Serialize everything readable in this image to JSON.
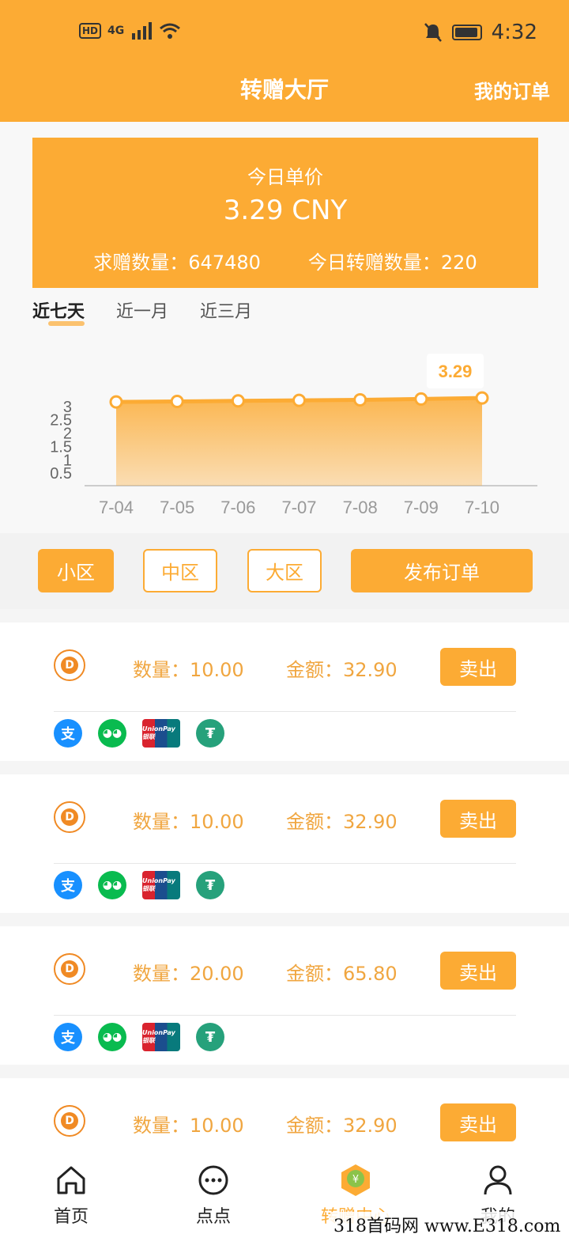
{
  "status_bar": {
    "network_hd": "HD",
    "network_gen": "4G",
    "time": "4:32"
  },
  "header": {
    "title": "转赠大厅",
    "my_orders": "我的订单"
  },
  "price_card": {
    "label": "今日单价",
    "value": "3.29 CNY",
    "request_label": "求赠数量：",
    "request_value": "647480",
    "today_label": "今日转赠数量：",
    "today_value": "220"
  },
  "ranges": [
    "近七天",
    "近一月",
    "近三月"
  ],
  "chart_data": {
    "type": "area",
    "x": [
      "7-04",
      "7-05",
      "7-06",
      "7-07",
      "7-08",
      "7-09",
      "7-10"
    ],
    "values": [
      3.14,
      3.16,
      3.18,
      3.2,
      3.22,
      3.25,
      3.29
    ],
    "y_ticks": [
      "0.5",
      "1",
      "1.5",
      "2",
      "2.5",
      "3"
    ],
    "ylim": [
      0,
      3.5
    ],
    "highlight_label": "3.29",
    "color": "#fcab34"
  },
  "zones": [
    "小区",
    "中区",
    "大区"
  ],
  "publish_label": "发布订单",
  "orders": [
    {
      "qty": "数量：10.00",
      "amount": "金额：32.90",
      "sell": "卖出"
    },
    {
      "qty": "数量：10.00",
      "amount": "金额：32.90",
      "sell": "卖出"
    },
    {
      "qty": "数量：20.00",
      "amount": "金额：65.80",
      "sell": "卖出"
    },
    {
      "qty": "数量：10.00",
      "amount": "金额：32.90",
      "sell": "卖出"
    }
  ],
  "payments": {
    "alipay": "支",
    "wechat": "◕◕",
    "unionpay": "UnionPay 银联",
    "tether": "₮"
  },
  "tabs": [
    "首页",
    "点点",
    "转赠中心",
    "我的"
  ],
  "watermark": "318首码网 www.E318.com"
}
